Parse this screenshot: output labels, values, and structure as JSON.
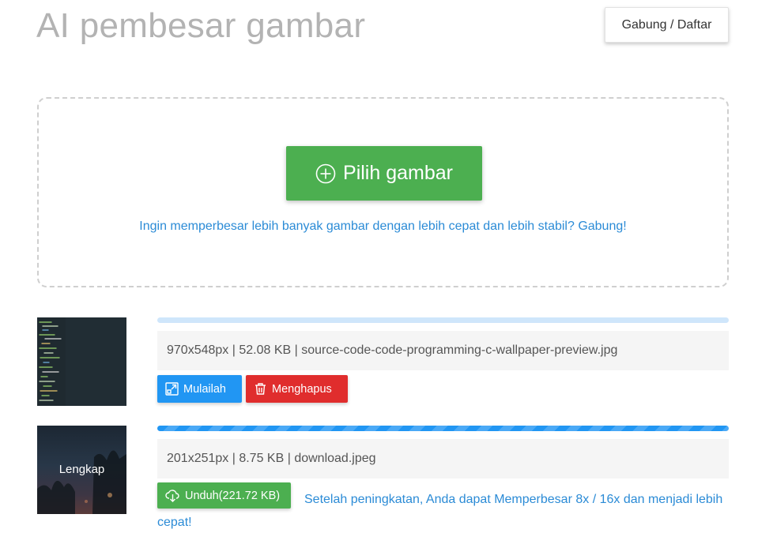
{
  "header": {
    "title": "AI pembesar gambar",
    "login_label": "Gabung / Daftar"
  },
  "upload": {
    "pick_label": "Pilih gambar",
    "join_text": "Ingin memperbesar lebih banyak gambar dengan lebih cepat dan lebih stabil? Gabung!"
  },
  "files": [
    {
      "info": "970x548px | 52.08 KB | source-code-code-programming-c-wallpaper-preview.jpg",
      "start_label": "Mulailah",
      "delete_label": "Menghapus",
      "progress": 0
    },
    {
      "thumb_label": "Lengkap",
      "info": "201x251px | 8.75 KB | download.jpeg",
      "download_label": "Unduh(221.72 KB)",
      "tip": "Setelah peningkatan, Anda dapat Memperbesar 8x / 16x dan menjadi lebih cepat!",
      "progress": 1
    }
  ],
  "colors": {
    "primary_green": "#4caf50",
    "primary_blue": "#2196f3",
    "danger_red": "#e02d2d",
    "link_blue": "#2b8bd6"
  },
  "icons": {
    "pick": "plus-circle-icon",
    "start": "expand-icon",
    "delete": "trash-icon",
    "download": "cloud-download-icon"
  }
}
